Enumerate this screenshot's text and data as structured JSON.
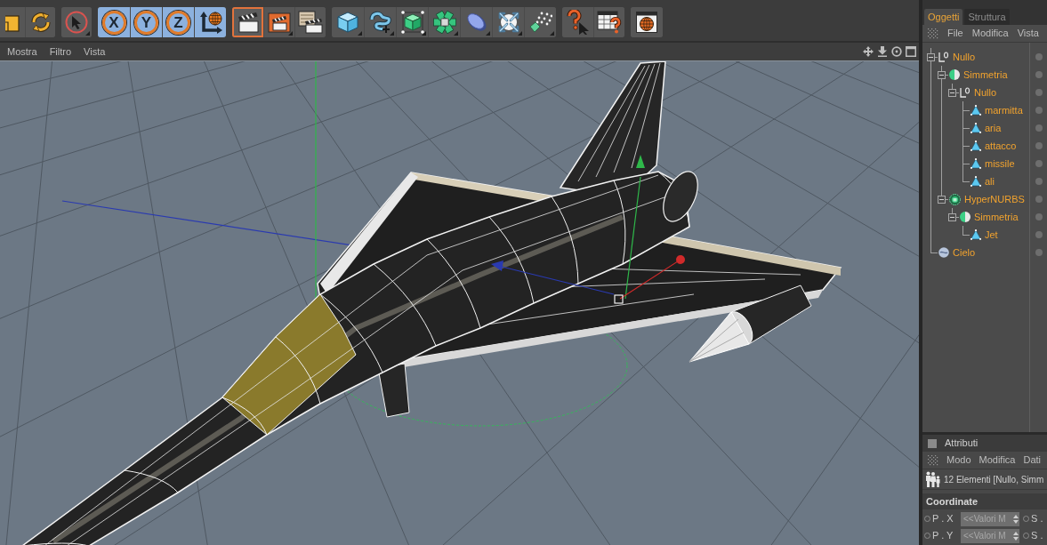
{
  "toolbar": {
    "groups": [
      {
        "buttons": [
          {
            "selected": false
          },
          {
            "selected": false
          }
        ]
      },
      {
        "buttons": [
          {
            "selected": false
          }
        ]
      },
      {
        "buttons": [
          {
            "label": "X",
            "selected": true
          },
          {
            "label": "Y",
            "selected": true
          },
          {
            "label": "Z",
            "selected": true
          },
          {
            "selected": true
          }
        ]
      },
      {
        "buttons": [
          {
            "selected": true
          },
          {
            "selected": false
          },
          {
            "selected": false
          }
        ]
      },
      {
        "buttons": [
          {
            "selected": false
          },
          {
            "selected": false
          },
          {
            "selected": false
          },
          {
            "selected": false
          },
          {
            "selected": false
          },
          {
            "selected": false
          },
          {
            "selected": false
          }
        ]
      },
      {
        "buttons": [
          {
            "selected": false
          },
          {
            "selected": false
          }
        ]
      },
      {
        "buttons": [
          {
            "selected": false
          }
        ]
      }
    ]
  },
  "viewport": {
    "menu": [
      "Mostra",
      "Filtro",
      "Vista"
    ]
  },
  "object_manager": {
    "tabs": [
      {
        "label": "Oggetti",
        "selected": true
      },
      {
        "label": "Struttura",
        "selected": false
      }
    ],
    "menu": [
      "File",
      "Modifica",
      "Vista"
    ],
    "tree": [
      {
        "label": "Nullo",
        "kind": "null",
        "selected": true,
        "expanded": true,
        "children": [
          {
            "label": "Simmetria",
            "kind": "symmetry",
            "selected": true,
            "expanded": true,
            "children": [
              {
                "label": "Nullo",
                "kind": "null",
                "selected": true,
                "expanded": true,
                "children": [
                  {
                    "label": "marmitta",
                    "kind": "polygon",
                    "selected": true
                  },
                  {
                    "label": "aria",
                    "kind": "polygon",
                    "selected": true
                  },
                  {
                    "label": "attacco",
                    "kind": "polygon",
                    "selected": true
                  },
                  {
                    "label": "missile",
                    "kind": "polygon",
                    "selected": true
                  },
                  {
                    "label": "ali",
                    "kind": "polygon",
                    "selected": true
                  }
                ]
              }
            ]
          },
          {
            "label": "HyperNURBS",
            "kind": "hypernurbs",
            "selected": true,
            "expanded": true,
            "children": [
              {
                "label": "Simmetria",
                "kind": "symmetry",
                "selected": true,
                "expanded": true,
                "children": [
                  {
                    "label": "Jet",
                    "kind": "polygon",
                    "selected": true
                  }
                ]
              }
            ]
          }
        ]
      },
      {
        "label": "Cielo",
        "kind": "sky",
        "selected": true
      }
    ]
  },
  "attribute_manager": {
    "title": "Attributi",
    "menu": [
      "Modo",
      "Modifica",
      "Dati"
    ],
    "selection": "12 Elementi [Nullo, Simm",
    "section": "Coordinate",
    "rows": [
      {
        "label": "P . X",
        "value": "<<Valori M",
        "label_2": "S ."
      },
      {
        "label": "P . Y",
        "value": "<<Valori M",
        "label_2": "S ."
      }
    ]
  }
}
